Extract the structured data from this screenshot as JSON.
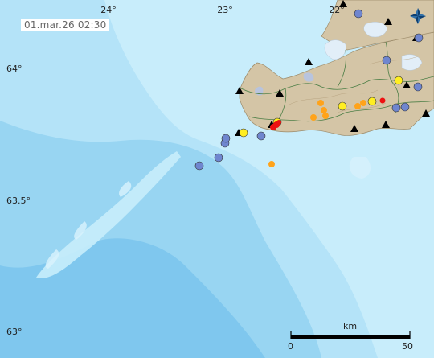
{
  "timestamp": "01.mar.26  02:30",
  "longitude_labels": [
    "−24°",
    "−23°",
    "−22°"
  ],
  "latitude_labels": [
    "64°",
    "63.5°",
    "63°"
  ],
  "scale_bar": {
    "unit": "km",
    "start_label": "0",
    "end_label": "50"
  },
  "marker_colors": {
    "blue": "#6f86cf",
    "yellow": "#ffee22",
    "orange": "#ffa31a",
    "red": "#ee1111",
    "station": "#000000"
  },
  "colors": {
    "deep_ocean": "#7fc7ee",
    "mid_ocean": "#a6dcf5",
    "shelf": "#c4ebfa",
    "land": "#d4c5a6",
    "ice": "#e2eef8"
  },
  "compass": "north-arrow-star"
}
